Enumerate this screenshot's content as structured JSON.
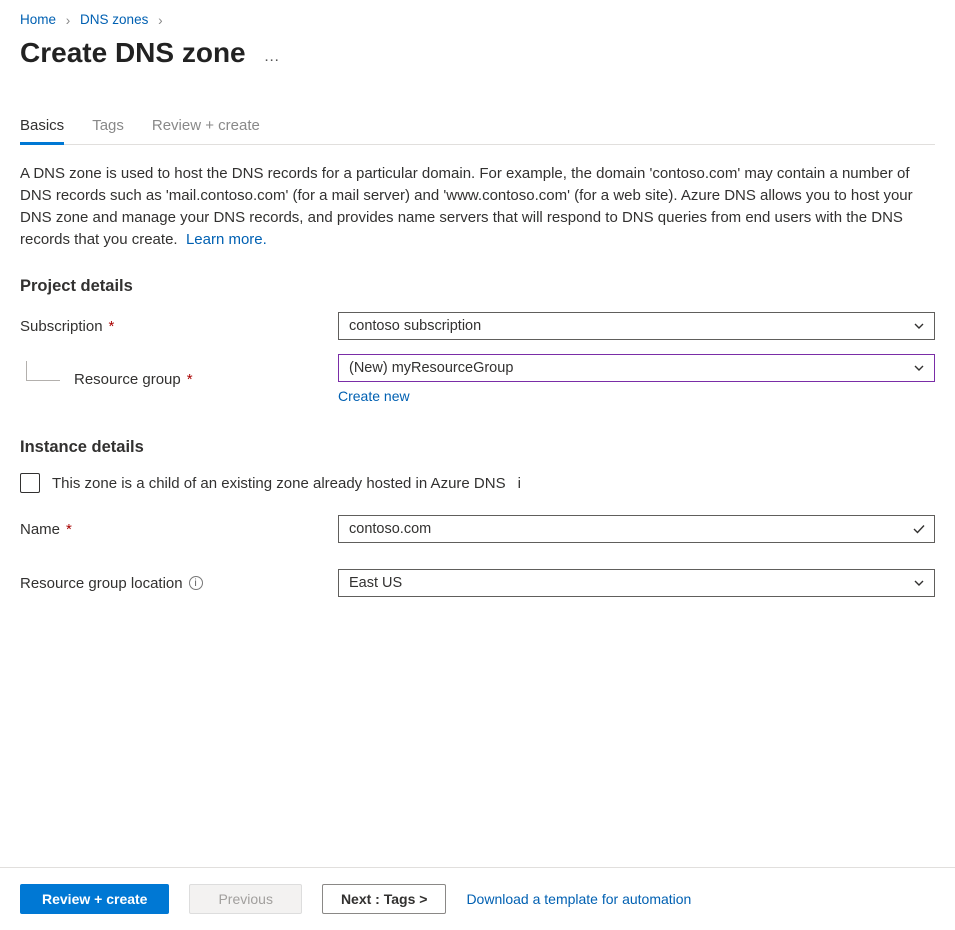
{
  "breadcrumb": {
    "items": [
      "Home",
      "DNS zones"
    ]
  },
  "page": {
    "title": "Create DNS zone",
    "more": "…"
  },
  "tabs": {
    "items": [
      "Basics",
      "Tags",
      "Review + create"
    ],
    "active": 0
  },
  "intro": {
    "text": "A DNS zone is used to host the DNS records for a particular domain. For example, the domain 'contoso.com' may contain a number of DNS records such as 'mail.contoso.com' (for a mail server) and 'www.contoso.com' (for a web site). Azure DNS allows you to host your DNS zone and manage your DNS records, and provides name servers that will respond to DNS queries from end users with the DNS records that you create.",
    "learn_more": "Learn more."
  },
  "sections": {
    "project": {
      "heading": "Project details",
      "subscription_label": "Subscription",
      "subscription_value": "contoso subscription",
      "resource_group_label": "Resource group",
      "resource_group_value": "(New) myResourceGroup",
      "create_new": "Create new"
    },
    "instance": {
      "heading": "Instance details",
      "child_zone_label": "This zone is a child of an existing zone already hosted in Azure DNS",
      "name_label": "Name",
      "name_value": "contoso.com",
      "rg_location_label": "Resource group location",
      "rg_location_value": "East US"
    }
  },
  "footer": {
    "review_create": "Review + create",
    "previous": "Previous",
    "next": "Next : Tags >",
    "download": "Download a template for automation"
  }
}
